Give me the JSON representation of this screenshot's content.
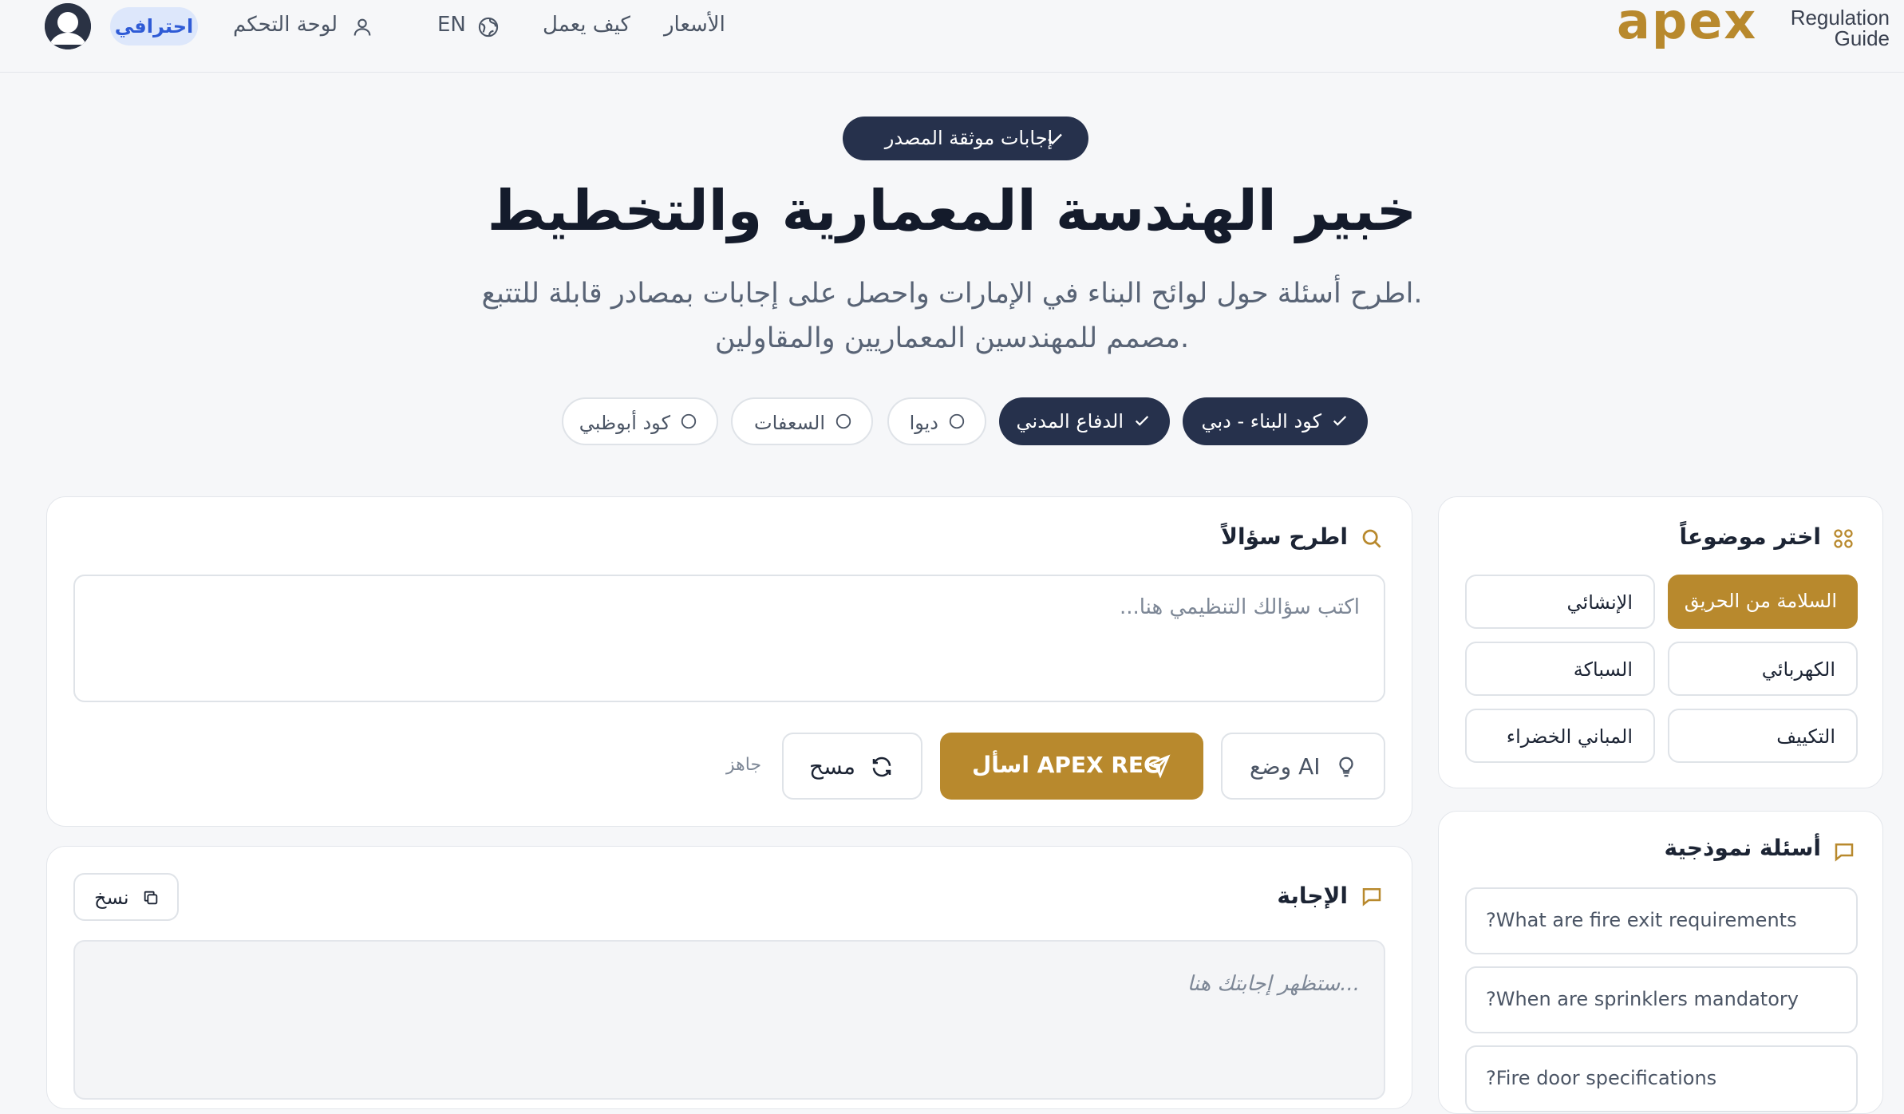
{
  "header": {
    "logo_word": "apex",
    "logo_subtitle_1": "Regulation",
    "logo_subtitle_2": "Guide",
    "nav": {
      "pricing": "الأسعار",
      "how_it_works": "كيف يعمل",
      "language": "EN",
      "dashboard": "لوحة التحكم"
    },
    "plan_badge": "احترافي"
  },
  "hero": {
    "badge": "إجابات موثقة المصدر",
    "title": "خبير الهندسة المعمارية والتخطيط",
    "subtitle_line1": "اطرح أسئلة حول لوائح البناء في الإمارات واحصل على إجابات بمصادر قابلة للتتبع.",
    "subtitle_line2": "مصمم للمهندسين المعماريين والمقاولين."
  },
  "sources": [
    {
      "label": "كود البناء - دبي",
      "selected": true
    },
    {
      "label": "الدفاع المدني",
      "selected": true
    },
    {
      "label": "ديوا",
      "selected": false
    },
    {
      "label": "السعفات",
      "selected": false
    },
    {
      "label": "كود أبوظبي",
      "selected": false
    }
  ],
  "ask": {
    "heading": "اطرح سؤالاً",
    "placeholder": "اكتب سؤالك التنظيمي هنا...",
    "value": "",
    "ai_mode_label": "وضع AI",
    "ask_button_label": "اسأل APEX REG",
    "clear_button_label": "مسح",
    "status": "جاهز"
  },
  "answer": {
    "heading": "الإجابة",
    "copy_label": "نسخ",
    "placeholder": "ستظهر إجابتك هنا..."
  },
  "topics": {
    "heading": "اختر موضوعاً",
    "items": [
      {
        "label": "السلامة من الحريق",
        "selected": true
      },
      {
        "label": "الإنشائي",
        "selected": false
      },
      {
        "label": "الكهربائي",
        "selected": false
      },
      {
        "label": "السباكة",
        "selected": false
      },
      {
        "label": "التكييف",
        "selected": false
      },
      {
        "label": "المباني الخضراء",
        "selected": false
      }
    ]
  },
  "samples": {
    "heading": "أسئلة نموذجية",
    "items": [
      "?What are fire exit requirements",
      "?When are sprinklers mandatory",
      "?Fire door specifications"
    ]
  },
  "colors": {
    "accent_gold": "#b8892d",
    "navy": "#26314c",
    "badge_blue_bg": "#dde7fb",
    "badge_blue_text": "#2f5bd6"
  },
  "icons": [
    "user-avatar-icon",
    "user-icon",
    "globe-icon",
    "check-icon",
    "circle-icon",
    "search-icon",
    "grid-icon",
    "chat-icon",
    "bulb-icon",
    "send-icon",
    "refresh-icon",
    "copy-icon"
  ]
}
